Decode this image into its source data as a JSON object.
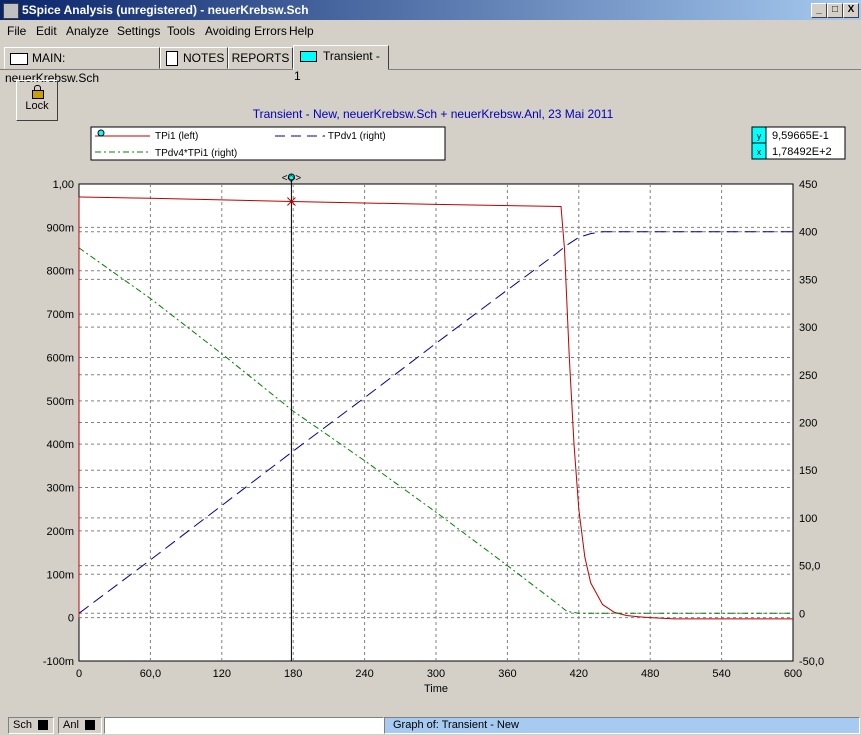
{
  "window": {
    "title": "5Spice Analysis (unregistered) - neuerKrebsw.Sch",
    "min_label": "_",
    "max_label": "□",
    "close_label": "X"
  },
  "menu": [
    "File",
    "Edit",
    "Analyze",
    "Settings",
    "Tools",
    "Avoiding Errors",
    "Help"
  ],
  "tabs": [
    {
      "label": "MAIN:  neuerKrebsw.Sch"
    },
    {
      "label": "NOTES"
    },
    {
      "label": "REPORTS"
    },
    {
      "label": "Transient - 1"
    }
  ],
  "lock_label": "Lock",
  "cursor_readout": {
    "y_label": "y",
    "x_label": "x",
    "y_value": "9,59665E-1",
    "x_value": "1,78492E+2"
  },
  "cursor_marker": "<◇>",
  "status": {
    "sch": "Sch",
    "anl": "Anl",
    "graph_of": "Graph of:  Transient - New"
  },
  "colors": {
    "tpi1": "#c00000",
    "tpdv1": "#00009a",
    "tpdv4": "#008000",
    "cursor": "#000000"
  },
  "chart_data": {
    "type": "line",
    "title": "Transient - New,    neuerKrebsw.Sch + neuerKrebsw.Anl,   23 Mai 2011",
    "xlabel": "Time",
    "xlim": [
      0,
      600
    ],
    "ylim_left": [
      -0.1,
      1.0
    ],
    "ylim_right": [
      -50,
      450
    ],
    "x_ticks": [
      "0",
      "60,0",
      "120",
      "180",
      "240",
      "300",
      "360",
      "420",
      "480",
      "540",
      "600"
    ],
    "y_left_ticks": [
      "1,00",
      "900m",
      "800m",
      "700m",
      "600m",
      "500m",
      "400m",
      "300m",
      "200m",
      "100m",
      "0",
      "-100m"
    ],
    "y_right_ticks": [
      "450",
      "400",
      "350",
      "300",
      "250",
      "200",
      "150",
      "100",
      "50,0",
      "0",
      "-50,0"
    ],
    "grid": true,
    "cursor_x": 178.492,
    "series": [
      {
        "name": "TPi1 (left)",
        "axis": "left",
        "style": "solid",
        "x": [
          0,
          0.5,
          1,
          60,
          178.492,
          300,
          405,
          408,
          412,
          416,
          420,
          425,
          430,
          440,
          450,
          460,
          470,
          480,
          500,
          600
        ],
        "y": [
          0.97,
          0.97,
          0.97,
          0.967,
          0.9597,
          0.953,
          0.948,
          0.85,
          0.6,
          0.4,
          0.25,
          0.14,
          0.08,
          0.03,
          0.012,
          0.005,
          0.002,
          0.0,
          -0.003,
          -0.003
        ]
      },
      {
        "name": "- TPdv1 (right)",
        "axis": "right",
        "style": "dash",
        "x": [
          0,
          60,
          120,
          180,
          240,
          300,
          360,
          400,
          410,
          420,
          430,
          440,
          600
        ],
        "y": [
          0,
          56,
          113,
          170,
          226,
          283,
          339,
          376,
          386,
          394,
          398,
          400,
          400
        ]
      },
      {
        "name": "TPdv4*TPi1 (right)",
        "axis": "right",
        "style": "dashdot",
        "x": [
          0,
          60,
          120,
          180,
          240,
          300,
          360,
          400,
          410,
          420,
          600
        ],
        "y": [
          383,
          330,
          272,
          212,
          160,
          106,
          50,
          12,
          2,
          0,
          0
        ]
      }
    ]
  }
}
